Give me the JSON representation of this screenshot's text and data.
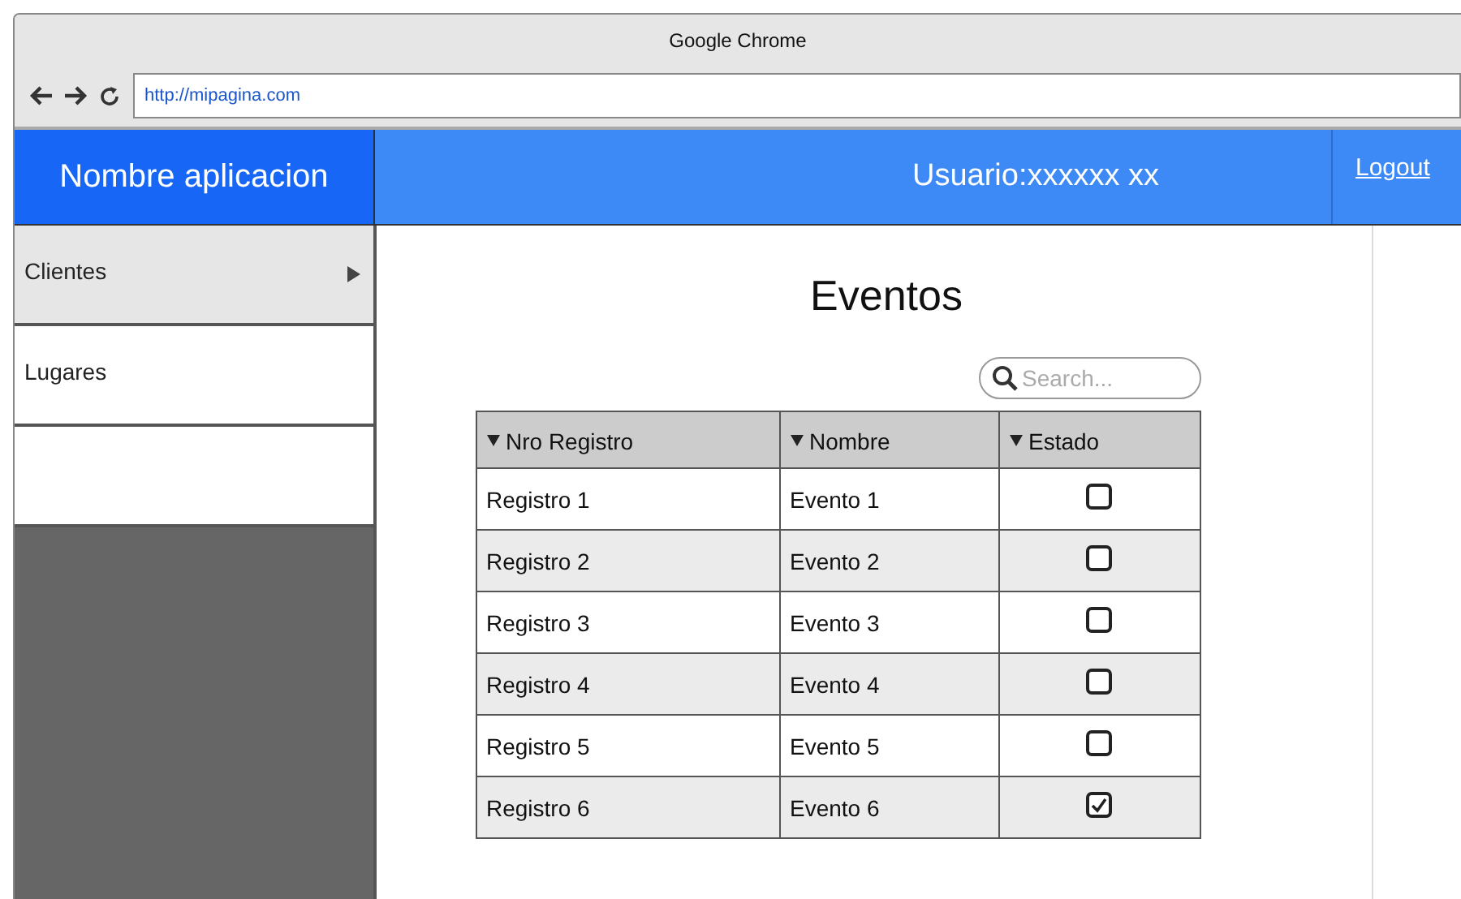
{
  "window": {
    "title": "Google Chrome",
    "url": "http://mipagina.com"
  },
  "header": {
    "app_name": "Nombre aplicacion",
    "user": "Usuario:xxxxxx xx",
    "logout": "Logout"
  },
  "sidebar": {
    "items": [
      {
        "label": "Clientes",
        "selected": true,
        "has_submenu": true
      },
      {
        "label": "Lugares",
        "selected": false,
        "has_submenu": false
      }
    ]
  },
  "page_title": "Eventos",
  "search": {
    "placeholder": "Search..."
  },
  "table": {
    "columns": [
      "Nro Registro",
      "Nombre",
      "Estado"
    ],
    "rows": [
      {
        "registro": "Registro 1",
        "nombre": "Evento 1",
        "checked": false
      },
      {
        "registro": "Registro 2",
        "nombre": "Evento 2",
        "checked": false
      },
      {
        "registro": "Registro 3",
        "nombre": "Evento 3",
        "checked": false
      },
      {
        "registro": "Registro 4",
        "nombre": "Evento 4",
        "checked": false
      },
      {
        "registro": "Registro 5",
        "nombre": "Evento 5",
        "checked": false
      },
      {
        "registro": "Registro 6",
        "nombre": "Evento 6",
        "checked": true
      }
    ]
  }
}
